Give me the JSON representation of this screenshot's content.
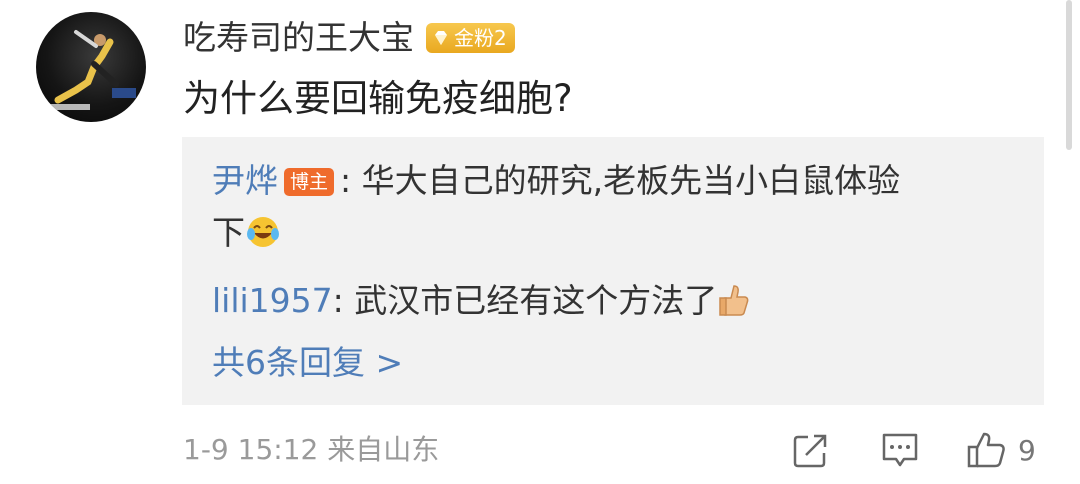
{
  "comment": {
    "username": "吃寿司的王大宝",
    "fan_badge": "金粉2",
    "text": "为什么要回输免疫细胞?"
  },
  "replies": [
    {
      "name": "尹烨",
      "author_badge": "博主",
      "separator": ":",
      "text_line1": " 华大自己的研究,老板先当小白鼠体验",
      "text_line2": "下",
      "emoji": "laugh-cry-emoji"
    },
    {
      "name": "lili1957",
      "separator": ":",
      "text": " 武汉市已经有这个方法了",
      "emoji": "thumbs-up-emoji"
    }
  ],
  "more_replies": "共6条回复 >",
  "footer": {
    "time_source": "1-9 15:12 来自山东",
    "like_count": "9",
    "icons": [
      "share-icon",
      "comment-icon",
      "like-icon"
    ]
  },
  "colors": {
    "link": "#4f7db8",
    "reply_bg": "#f2f2f2",
    "gold_badge": "#eeb02a",
    "author_badge": "#ef6b2c",
    "meta_text": "#9a9a9a"
  }
}
